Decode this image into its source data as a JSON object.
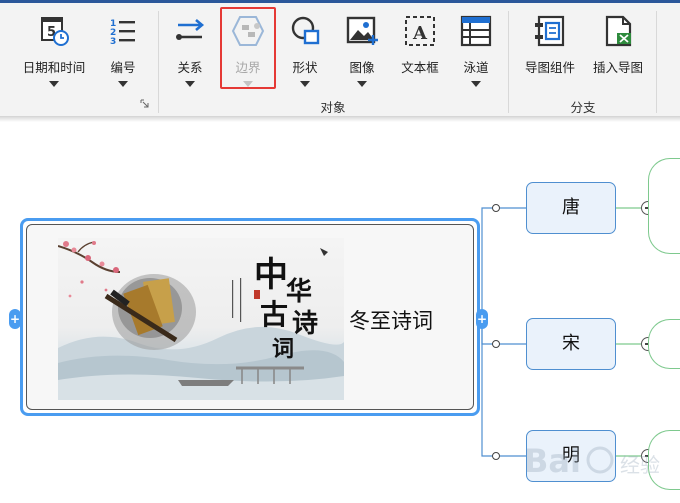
{
  "ribbon": {
    "tools": [
      {
        "key": "datetime",
        "label": "日期和时间",
        "has_caret": true
      },
      {
        "key": "numbering",
        "label": "编号",
        "has_caret": true
      },
      {
        "key": "relation",
        "label": "关系",
        "has_caret": true
      },
      {
        "key": "boundary",
        "label": "边界",
        "has_caret": true,
        "disabled": true,
        "highlighted": true
      },
      {
        "key": "shape",
        "label": "形状",
        "has_caret": true
      },
      {
        "key": "image",
        "label": "图像",
        "has_caret": true
      },
      {
        "key": "textbox",
        "label": "文本框",
        "has_caret": false
      },
      {
        "key": "swimlane",
        "label": "泳道",
        "has_caret": true
      },
      {
        "key": "map_component",
        "label": "导图组件",
        "has_caret": false
      },
      {
        "key": "insert_map",
        "label": "插入导图",
        "has_caret": false
      }
    ],
    "groups": {
      "object": "对象",
      "branch": "分支"
    }
  },
  "mindmap": {
    "main_topic": "冬至诗词",
    "subtopics": [
      "唐",
      "宋",
      "明"
    ],
    "image_text": {
      "title_1": "中",
      "title_2": "华",
      "title_3": "古",
      "title_4": "诗",
      "title_5": "词"
    }
  },
  "colors": {
    "accent": "#4a9cf0",
    "subtopic_border": "#4f8fd0",
    "subtopic_fill": "#eaf2fb",
    "highlight": "#e53935",
    "green_branch": "#7ec98e"
  },
  "watermark": {
    "text": "Bai",
    "text2": "经验"
  }
}
